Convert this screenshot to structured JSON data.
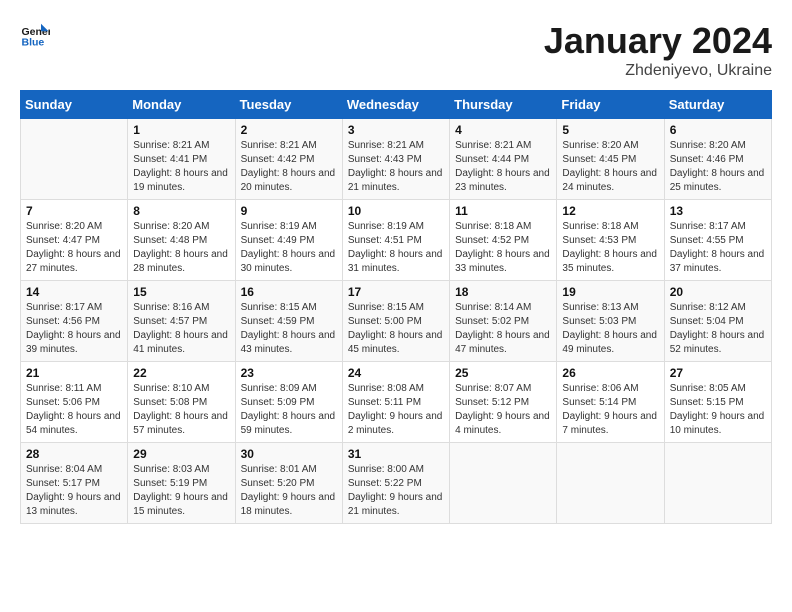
{
  "logo": {
    "line1": "General",
    "line2": "Blue"
  },
  "title": "January 2024",
  "subtitle": "Zhdeniyevo, Ukraine",
  "weekdays": [
    "Sunday",
    "Monday",
    "Tuesday",
    "Wednesday",
    "Thursday",
    "Friday",
    "Saturday"
  ],
  "weeks": [
    [
      {
        "day": "",
        "sunrise": "",
        "sunset": "",
        "daylight": ""
      },
      {
        "day": "1",
        "sunrise": "Sunrise: 8:21 AM",
        "sunset": "Sunset: 4:41 PM",
        "daylight": "Daylight: 8 hours and 19 minutes."
      },
      {
        "day": "2",
        "sunrise": "Sunrise: 8:21 AM",
        "sunset": "Sunset: 4:42 PM",
        "daylight": "Daylight: 8 hours and 20 minutes."
      },
      {
        "day": "3",
        "sunrise": "Sunrise: 8:21 AM",
        "sunset": "Sunset: 4:43 PM",
        "daylight": "Daylight: 8 hours and 21 minutes."
      },
      {
        "day": "4",
        "sunrise": "Sunrise: 8:21 AM",
        "sunset": "Sunset: 4:44 PM",
        "daylight": "Daylight: 8 hours and 23 minutes."
      },
      {
        "day": "5",
        "sunrise": "Sunrise: 8:20 AM",
        "sunset": "Sunset: 4:45 PM",
        "daylight": "Daylight: 8 hours and 24 minutes."
      },
      {
        "day": "6",
        "sunrise": "Sunrise: 8:20 AM",
        "sunset": "Sunset: 4:46 PM",
        "daylight": "Daylight: 8 hours and 25 minutes."
      }
    ],
    [
      {
        "day": "7",
        "sunrise": "Sunrise: 8:20 AM",
        "sunset": "Sunset: 4:47 PM",
        "daylight": "Daylight: 8 hours and 27 minutes."
      },
      {
        "day": "8",
        "sunrise": "Sunrise: 8:20 AM",
        "sunset": "Sunset: 4:48 PM",
        "daylight": "Daylight: 8 hours and 28 minutes."
      },
      {
        "day": "9",
        "sunrise": "Sunrise: 8:19 AM",
        "sunset": "Sunset: 4:49 PM",
        "daylight": "Daylight: 8 hours and 30 minutes."
      },
      {
        "day": "10",
        "sunrise": "Sunrise: 8:19 AM",
        "sunset": "Sunset: 4:51 PM",
        "daylight": "Daylight: 8 hours and 31 minutes."
      },
      {
        "day": "11",
        "sunrise": "Sunrise: 8:18 AM",
        "sunset": "Sunset: 4:52 PM",
        "daylight": "Daylight: 8 hours and 33 minutes."
      },
      {
        "day": "12",
        "sunrise": "Sunrise: 8:18 AM",
        "sunset": "Sunset: 4:53 PM",
        "daylight": "Daylight: 8 hours and 35 minutes."
      },
      {
        "day": "13",
        "sunrise": "Sunrise: 8:17 AM",
        "sunset": "Sunset: 4:55 PM",
        "daylight": "Daylight: 8 hours and 37 minutes."
      }
    ],
    [
      {
        "day": "14",
        "sunrise": "Sunrise: 8:17 AM",
        "sunset": "Sunset: 4:56 PM",
        "daylight": "Daylight: 8 hours and 39 minutes."
      },
      {
        "day": "15",
        "sunrise": "Sunrise: 8:16 AM",
        "sunset": "Sunset: 4:57 PM",
        "daylight": "Daylight: 8 hours and 41 minutes."
      },
      {
        "day": "16",
        "sunrise": "Sunrise: 8:15 AM",
        "sunset": "Sunset: 4:59 PM",
        "daylight": "Daylight: 8 hours and 43 minutes."
      },
      {
        "day": "17",
        "sunrise": "Sunrise: 8:15 AM",
        "sunset": "Sunset: 5:00 PM",
        "daylight": "Daylight: 8 hours and 45 minutes."
      },
      {
        "day": "18",
        "sunrise": "Sunrise: 8:14 AM",
        "sunset": "Sunset: 5:02 PM",
        "daylight": "Daylight: 8 hours and 47 minutes."
      },
      {
        "day": "19",
        "sunrise": "Sunrise: 8:13 AM",
        "sunset": "Sunset: 5:03 PM",
        "daylight": "Daylight: 8 hours and 49 minutes."
      },
      {
        "day": "20",
        "sunrise": "Sunrise: 8:12 AM",
        "sunset": "Sunset: 5:04 PM",
        "daylight": "Daylight: 8 hours and 52 minutes."
      }
    ],
    [
      {
        "day": "21",
        "sunrise": "Sunrise: 8:11 AM",
        "sunset": "Sunset: 5:06 PM",
        "daylight": "Daylight: 8 hours and 54 minutes."
      },
      {
        "day": "22",
        "sunrise": "Sunrise: 8:10 AM",
        "sunset": "Sunset: 5:08 PM",
        "daylight": "Daylight: 8 hours and 57 minutes."
      },
      {
        "day": "23",
        "sunrise": "Sunrise: 8:09 AM",
        "sunset": "Sunset: 5:09 PM",
        "daylight": "Daylight: 8 hours and 59 minutes."
      },
      {
        "day": "24",
        "sunrise": "Sunrise: 8:08 AM",
        "sunset": "Sunset: 5:11 PM",
        "daylight": "Daylight: 9 hours and 2 minutes."
      },
      {
        "day": "25",
        "sunrise": "Sunrise: 8:07 AM",
        "sunset": "Sunset: 5:12 PM",
        "daylight": "Daylight: 9 hours and 4 minutes."
      },
      {
        "day": "26",
        "sunrise": "Sunrise: 8:06 AM",
        "sunset": "Sunset: 5:14 PM",
        "daylight": "Daylight: 9 hours and 7 minutes."
      },
      {
        "day": "27",
        "sunrise": "Sunrise: 8:05 AM",
        "sunset": "Sunset: 5:15 PM",
        "daylight": "Daylight: 9 hours and 10 minutes."
      }
    ],
    [
      {
        "day": "28",
        "sunrise": "Sunrise: 8:04 AM",
        "sunset": "Sunset: 5:17 PM",
        "daylight": "Daylight: 9 hours and 13 minutes."
      },
      {
        "day": "29",
        "sunrise": "Sunrise: 8:03 AM",
        "sunset": "Sunset: 5:19 PM",
        "daylight": "Daylight: 9 hours and 15 minutes."
      },
      {
        "day": "30",
        "sunrise": "Sunrise: 8:01 AM",
        "sunset": "Sunset: 5:20 PM",
        "daylight": "Daylight: 9 hours and 18 minutes."
      },
      {
        "day": "31",
        "sunrise": "Sunrise: 8:00 AM",
        "sunset": "Sunset: 5:22 PM",
        "daylight": "Daylight: 9 hours and 21 minutes."
      },
      {
        "day": "",
        "sunrise": "",
        "sunset": "",
        "daylight": ""
      },
      {
        "day": "",
        "sunrise": "",
        "sunset": "",
        "daylight": ""
      },
      {
        "day": "",
        "sunrise": "",
        "sunset": "",
        "daylight": ""
      }
    ]
  ]
}
